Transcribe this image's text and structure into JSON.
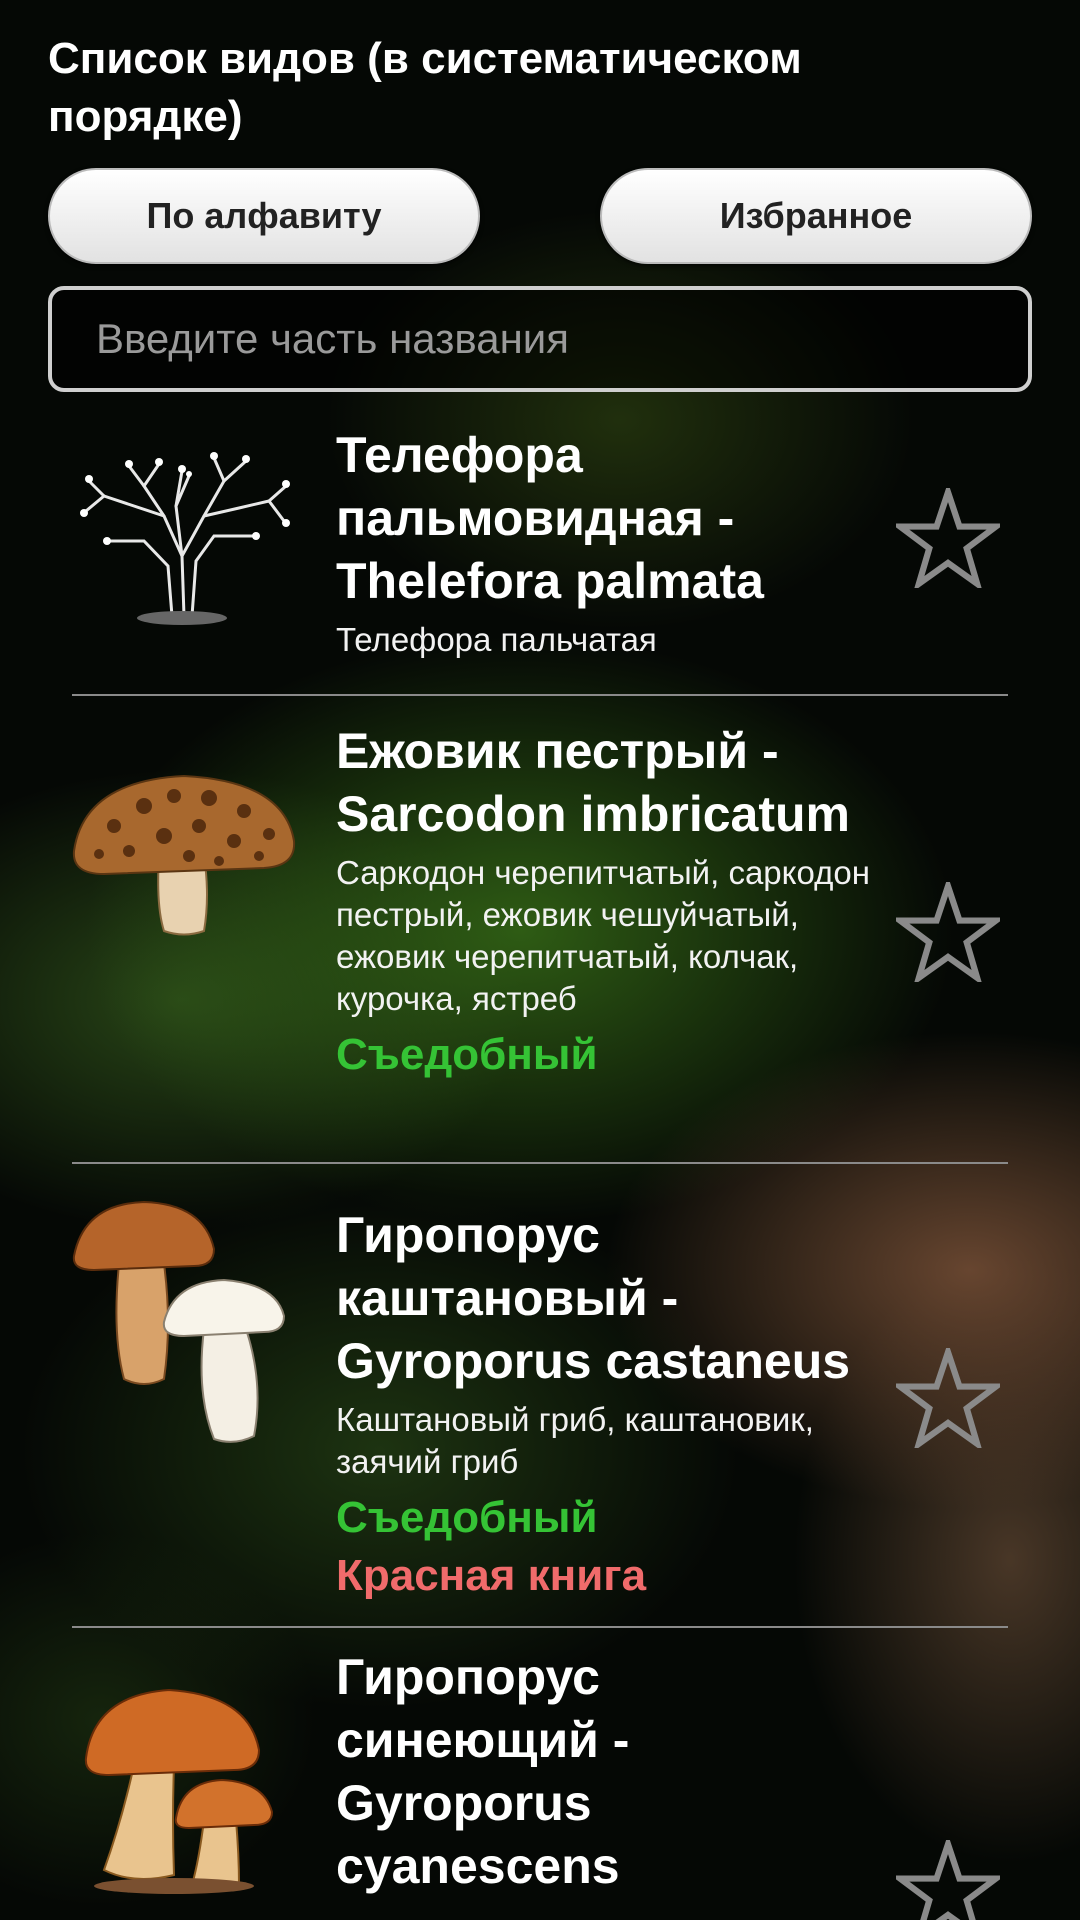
{
  "header": {
    "title": "Список видов (в систематическом порядке)"
  },
  "buttons": {
    "alphabet_label": "По алфавиту",
    "favorites_label": "Избранное"
  },
  "search": {
    "placeholder": "Введите часть названия",
    "value": ""
  },
  "colors": {
    "edible": "#35c335",
    "red_book": "#f06b6b",
    "star_outline": "#8a8a8a"
  },
  "items": [
    {
      "name": "Телефора пальмовидная - Thelefora palmata",
      "synonyms": "Телефора пальчатая",
      "edibility": "",
      "status": "",
      "icon": "coral-fungus-drawing",
      "favorite": false
    },
    {
      "name": "Ежовик пестрый - Sarcodon imbricatum",
      "synonyms": "Саркодон черепитчатый, саркодон пестрый, ежовик чешуйчатый, ежовик черепитчатый, колчак, курочка, ястреб",
      "edibility": "Съедобный",
      "status": "",
      "icon": "scaly-mushroom",
      "favorite": false
    },
    {
      "name": "Гиропорус каштановый - Gyroporus castaneus",
      "synonyms": "Каштановый гриб, каштановик, заячий гриб",
      "edibility": "Съедобный",
      "status": "Красная книга",
      "icon": "chestnut-bolete",
      "favorite": false
    },
    {
      "name": "Гиропорус синеющий - Gyroporus cyanescens",
      "synonyms": "",
      "edibility": "",
      "status": "",
      "icon": "cornflower-bolete",
      "favorite": false
    }
  ]
}
